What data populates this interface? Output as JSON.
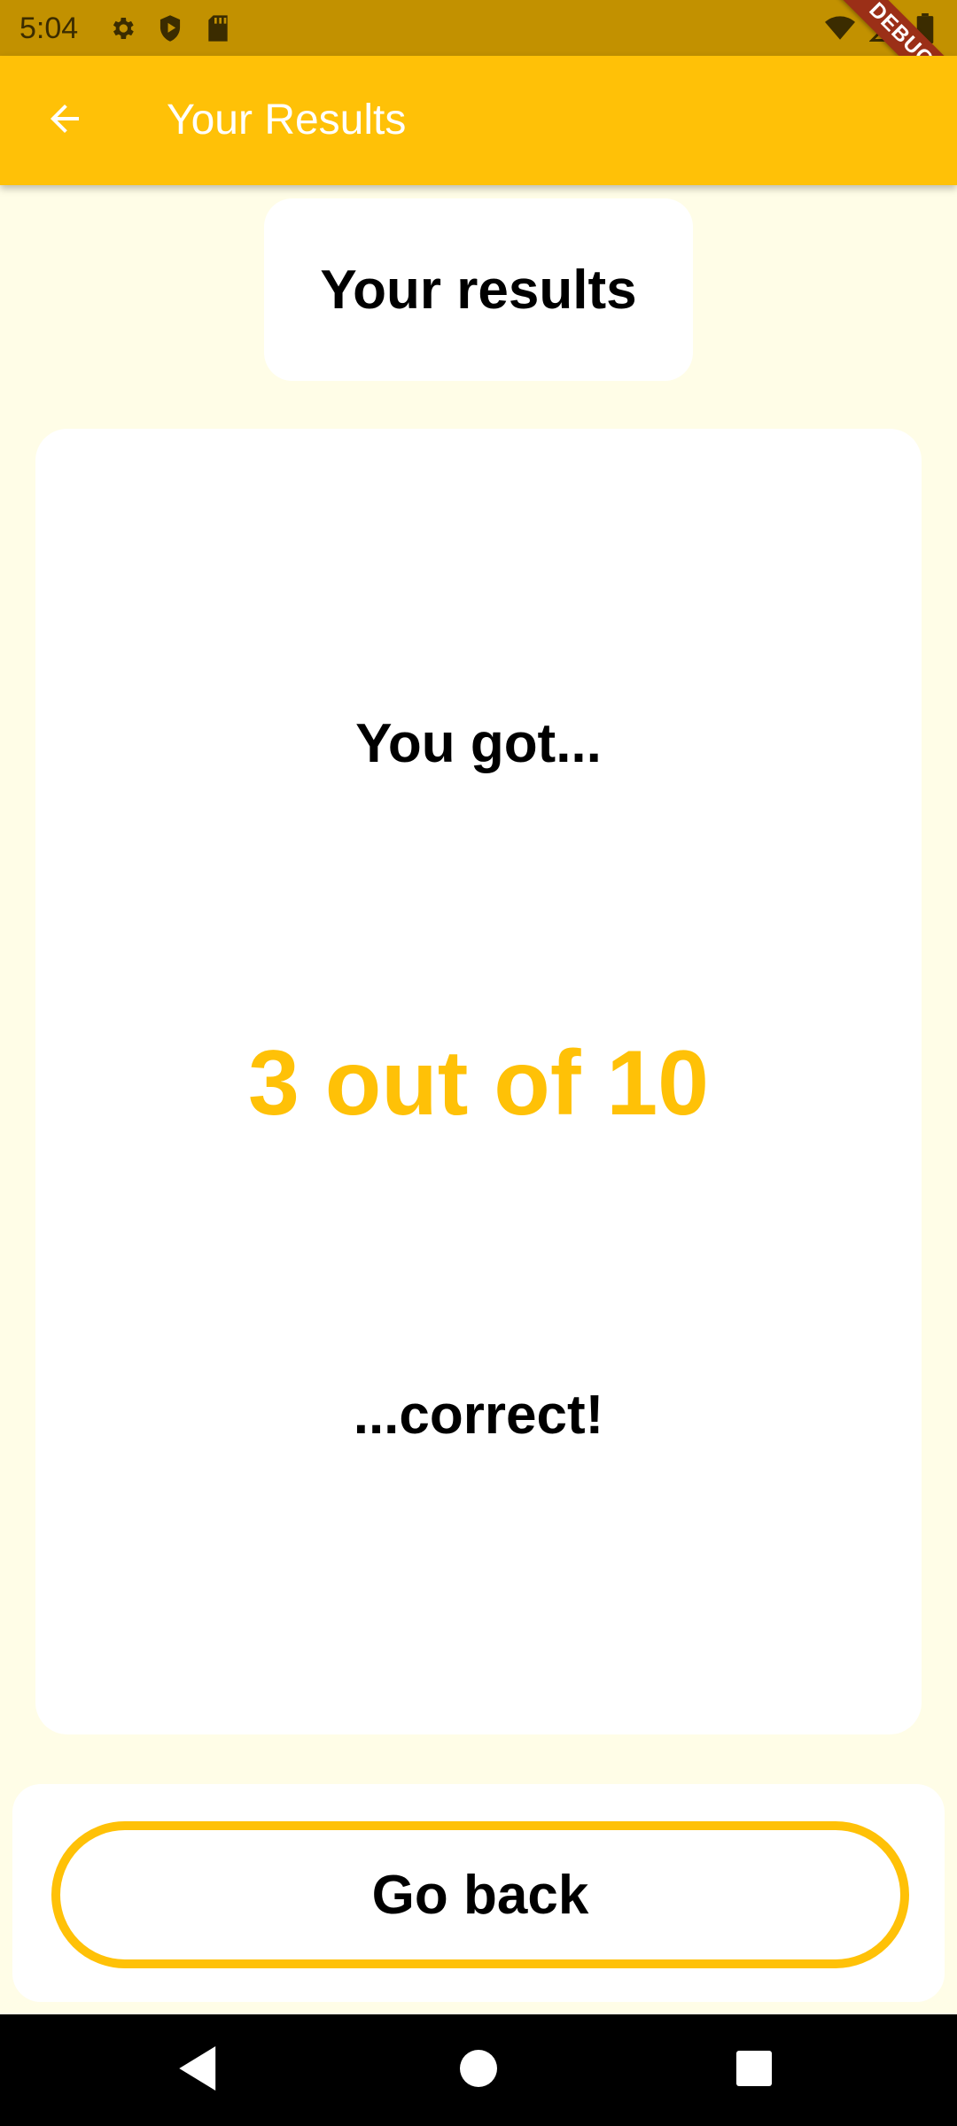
{
  "status_bar": {
    "time": "5:04",
    "left_icons": [
      "gear-icon",
      "shield-play-icon",
      "sd-card-icon"
    ],
    "right_icons": [
      "wifi-icon",
      "signal-icon",
      "battery-icon"
    ]
  },
  "debug_banner": {
    "label": "DEBUG"
  },
  "app_bar": {
    "title": "Your Results",
    "back_icon": "arrow-back-icon"
  },
  "header": {
    "title": "Your results"
  },
  "result": {
    "intro": "You got...",
    "score_text": "3 out of 10",
    "outro": "...correct!",
    "correct_count": 3,
    "total_count": 10
  },
  "actions": {
    "go_back_label": "Go back"
  },
  "nav_bar": {
    "buttons": [
      "back-triangle-icon",
      "home-circle-icon",
      "recents-square-icon"
    ]
  },
  "colors": {
    "accent": "#ffc107",
    "status_bar": "#c29100",
    "background": "#fffde7",
    "debug_ribbon": "#9b2f17"
  }
}
